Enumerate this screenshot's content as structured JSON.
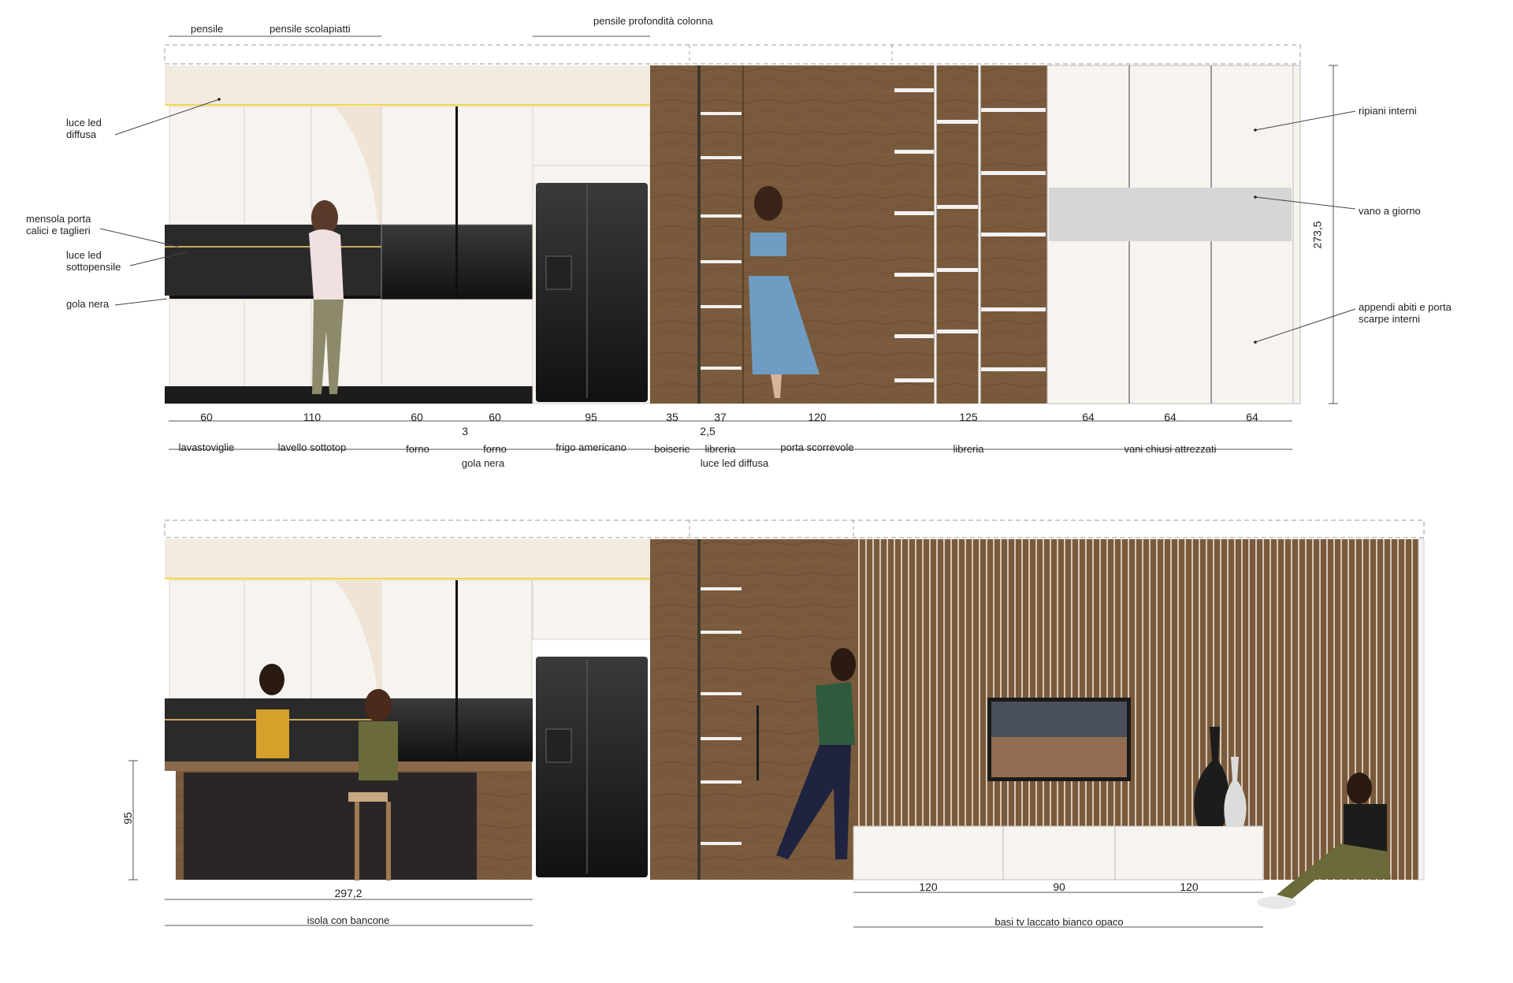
{
  "colors": {
    "wood": "#7a5a3c",
    "wood_dark": "#5e4229",
    "cabinet_white": "#f7f4ef",
    "soffit_cream": "#f2ebe0",
    "black": "#1c1c1c",
    "led_yellow": "#f0d84a",
    "grey_niche": "#d6d6d6"
  },
  "top": {
    "upper_labels": [
      "pensile",
      "pensile scolapiatti",
      "pensile profondità colonna"
    ],
    "left_notes": [
      "luce led diffusa",
      "mensola porta calici e taglieri",
      "luce led sottopensile",
      "gola nera"
    ],
    "right_notes": [
      "ripiani interni",
      "vano a giorno",
      "appendi abiti e porta scarpe interni"
    ],
    "height_dim": "273,5",
    "dims": [
      "60",
      "110",
      "60",
      "3",
      "60",
      "95",
      "35",
      "37",
      "2,5",
      "120",
      "125",
      "64",
      "64",
      "64"
    ],
    "names": [
      "lavastoviglie",
      "lavello sottotop",
      "forno",
      "gola nera",
      "forno",
      "frigo americano",
      "boiserie",
      "libreria",
      "luce led diffusa",
      "porta scorrevole",
      "libreria",
      "vani chiusi attrezzati"
    ]
  },
  "bottom": {
    "height_dim": "95",
    "island_dim": "297,2",
    "island_name": "isola con bancone",
    "tv_dims": [
      "120",
      "90",
      "120"
    ],
    "tv_name": "basi tv laccato bianco opaco"
  }
}
